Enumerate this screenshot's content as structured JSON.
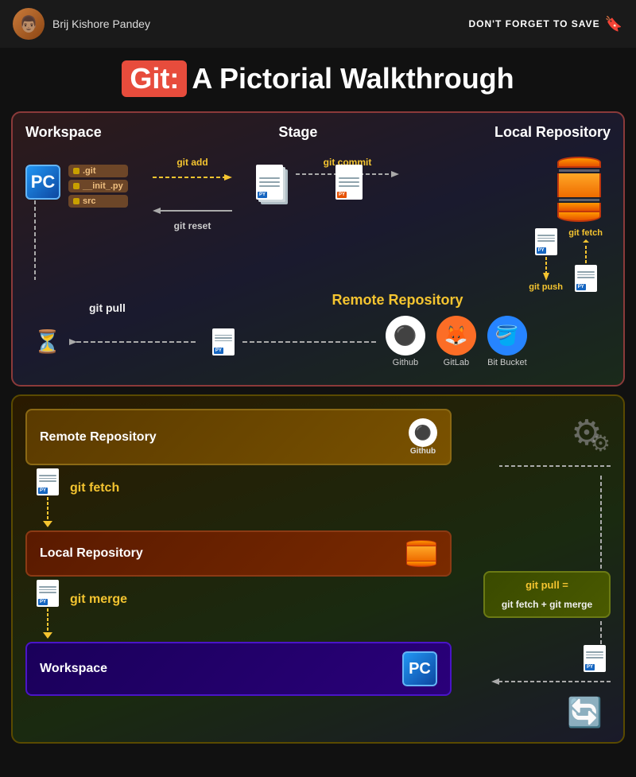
{
  "header": {
    "author": "Brij Kishore Pandey",
    "save_label": "DON'T FORGET TO SAVE"
  },
  "title": {
    "git_label": "Git:",
    "subtitle": "A Pictorial Walkthrough"
  },
  "top_diagram": {
    "sections": [
      "Workspace",
      "Stage",
      "Local Repository"
    ],
    "files": [
      ".git",
      "__init_.py",
      "src"
    ],
    "commands": {
      "git_add": "git add",
      "git_reset": "git reset",
      "git_commit": "git commit",
      "git_push": "git push",
      "git_fetch": "git fetch",
      "git_pull": "git pull"
    },
    "remote_label": "Remote Repository",
    "remote_services": [
      {
        "name": "Github",
        "symbol": "🐙"
      },
      {
        "name": "GitLab",
        "symbol": "🦊"
      },
      {
        "name": "Bit Bucket",
        "symbol": "🪣"
      }
    ]
  },
  "bottom_diagram": {
    "remote_box": "Remote Repository",
    "local_box": "Local Repository",
    "workspace_box": "Workspace",
    "gitpull_box": "git pull =\ngit fetch + git merge",
    "git_fetch_label": "git fetch",
    "git_merge_label": "git merge"
  }
}
